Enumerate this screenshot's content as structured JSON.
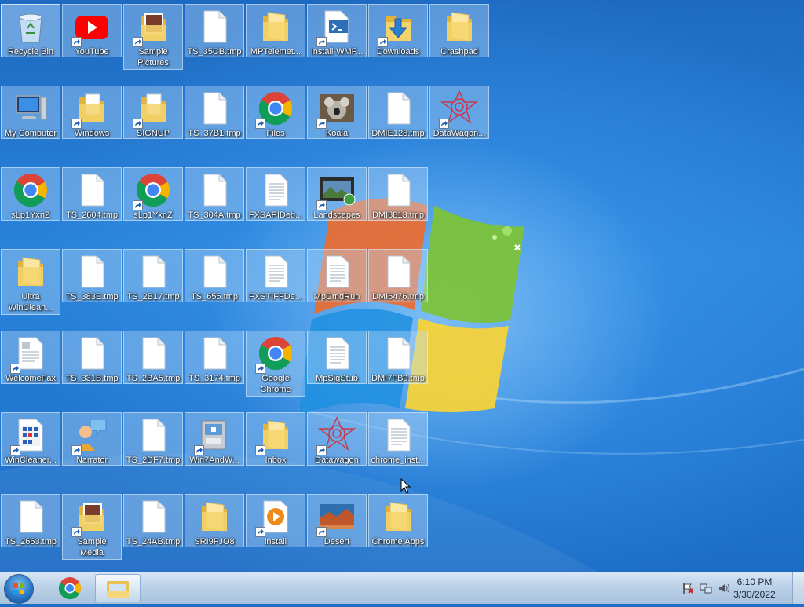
{
  "desktop": {
    "icons": [
      {
        "label": "Recycle Bin",
        "type": "recycle",
        "shortcut": false,
        "selected": true
      },
      {
        "label": "YouTube",
        "type": "youtube",
        "shortcut": true
      },
      {
        "label": "Sample\nPictures",
        "type": "folder-pic",
        "shortcut": true,
        "tall": true
      },
      {
        "label": "TS_35CB.tmp",
        "type": "file",
        "shortcut": false
      },
      {
        "label": "MPTelemet...",
        "type": "folder",
        "shortcut": false
      },
      {
        "label": "Install-WMF...",
        "type": "ps",
        "shortcut": true
      },
      {
        "label": "Downloads",
        "type": "downloads",
        "shortcut": true
      },
      {
        "label": "Crashpad",
        "type": "folder",
        "shortcut": false
      },
      {
        "label": "My Computer",
        "type": "computer",
        "shortcut": false
      },
      {
        "label": "Windows",
        "type": "folder-doc",
        "shortcut": true
      },
      {
        "label": "SIGNUP",
        "type": "folder-doc",
        "shortcut": true
      },
      {
        "label": "TS_37B1.tmp",
        "type": "file",
        "shortcut": false
      },
      {
        "label": "Files",
        "type": "chrome",
        "shortcut": true
      },
      {
        "label": "Koala",
        "type": "koala",
        "shortcut": true
      },
      {
        "label": "DMIE128.tmp",
        "type": "file",
        "shortcut": false
      },
      {
        "label": "DataWagon...",
        "type": "datawagon",
        "shortcut": true
      },
      {
        "label": "sLp1YxnZ",
        "type": "chrome",
        "shortcut": false
      },
      {
        "label": "TS_2604.tmp",
        "type": "file",
        "shortcut": false
      },
      {
        "label": "sLp1YxnZ",
        "type": "chrome",
        "shortcut": true
      },
      {
        "label": "TS_304A.tmp",
        "type": "file",
        "shortcut": false
      },
      {
        "label": "FXSAPIDeb...",
        "type": "textfile",
        "shortcut": false
      },
      {
        "label": "Landscapes",
        "type": "landscape",
        "shortcut": true
      },
      {
        "label": "DMI8813.tmp",
        "type": "file",
        "shortcut": false
      },
      {
        "label": "Ultra\nWinClean...",
        "type": "folder",
        "shortcut": false,
        "tall": true
      },
      {
        "label": "TS_383E.tmp",
        "type": "file",
        "shortcut": false
      },
      {
        "label": "TS_2B17.tmp",
        "type": "file",
        "shortcut": false
      },
      {
        "label": "TS_655.tmp",
        "type": "file",
        "shortcut": false
      },
      {
        "label": "FXSTIFFDe...",
        "type": "textfile",
        "shortcut": false
      },
      {
        "label": "MpCmdRun",
        "type": "textfile",
        "shortcut": false
      },
      {
        "label": "DMI6476.tmp",
        "type": "file",
        "shortcut": false
      },
      {
        "label": "WelcomeFax",
        "type": "doc",
        "shortcut": true
      },
      {
        "label": "TS_331B.tmp",
        "type": "file",
        "shortcut": false
      },
      {
        "label": "TS_2BA5.tmp",
        "type": "file",
        "shortcut": false
      },
      {
        "label": "TS_3174.tmp",
        "type": "file",
        "shortcut": false
      },
      {
        "label": "Google\nChrome",
        "type": "chrome",
        "shortcut": true,
        "tall": true
      },
      {
        "label": "MpSigStub",
        "type": "textfile",
        "shortcut": false
      },
      {
        "label": "DMI7FB9.tmp",
        "type": "file",
        "shortcut": false
      },
      {
        "label": "WinCleaner...",
        "type": "calendar",
        "shortcut": true
      },
      {
        "label": "Narrator",
        "type": "narrator",
        "shortcut": true
      },
      {
        "label": "TS_2DF7.tmp",
        "type": "file",
        "shortcut": false
      },
      {
        "label": "Win7AndW...",
        "type": "installer",
        "shortcut": true
      },
      {
        "label": "Inbox",
        "type": "folder",
        "shortcut": true
      },
      {
        "label": "Datawagon",
        "type": "datawagon",
        "shortcut": true
      },
      {
        "label": "chrome_inst...",
        "type": "textfile",
        "shortcut": false
      },
      {
        "label": "TS_2663.tmp",
        "type": "file",
        "shortcut": false
      },
      {
        "label": "Sample\nMedia",
        "type": "folder-pic",
        "shortcut": true,
        "tall": true
      },
      {
        "label": "TS_24AB.tmp",
        "type": "file",
        "shortcut": false
      },
      {
        "label": "SRI9FJO8",
        "type": "folder",
        "shortcut": false
      },
      {
        "label": "install",
        "type": "media",
        "shortcut": true
      },
      {
        "label": "Desert",
        "type": "desert",
        "shortcut": true
      },
      {
        "label": "Chrome Apps",
        "type": "folder",
        "shortcut": false
      }
    ]
  },
  "taskbar": {
    "pinned": [
      "chrome-icon",
      "explorer-icon"
    ],
    "tray": {
      "time": "6:10 PM",
      "date": "3/30/2022"
    }
  },
  "colors": {
    "desktop_blue": "#1f6fc4",
    "folder_yellow": "#f3d36b",
    "chrome_red": "#db4437",
    "chrome_green": "#0f9d58",
    "chrome_yellow": "#f4b400",
    "chrome_blue": "#4285f4"
  }
}
